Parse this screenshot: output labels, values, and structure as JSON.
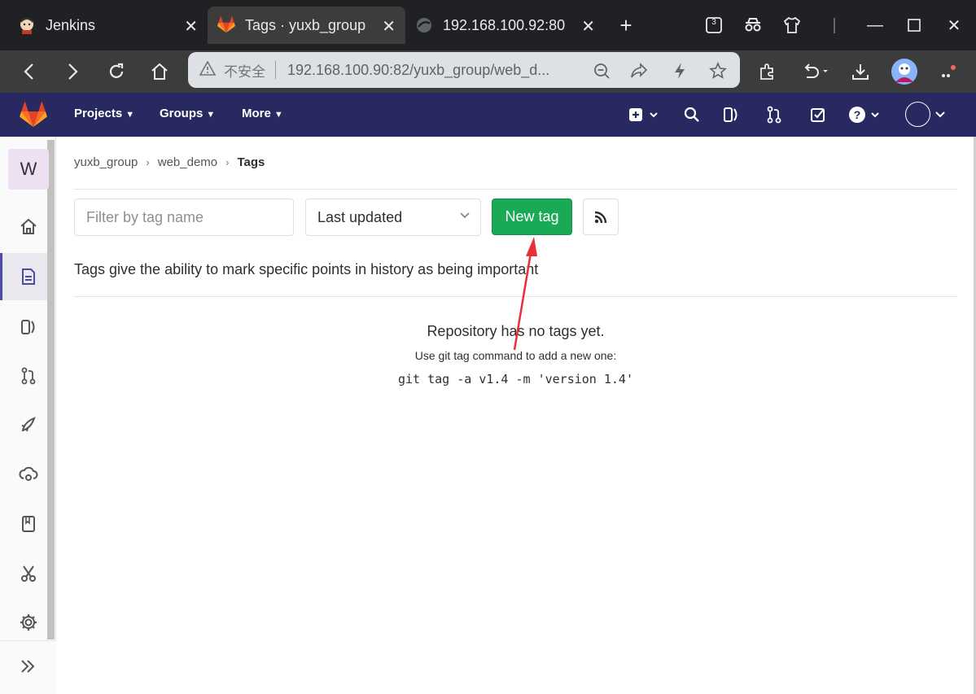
{
  "browser": {
    "tabs": [
      {
        "title": "Jenkins"
      },
      {
        "title": "Tags · yuxb_group"
      },
      {
        "title": "192.168.100.92:80"
      }
    ],
    "badge_count": "3",
    "insecure_label": "不安全",
    "url": "192.168.100.90:82/yuxb_group/web_d..."
  },
  "gitlab_nav": {
    "projects": "Projects",
    "groups": "Groups",
    "more": "More"
  },
  "sidebar": {
    "project_initial": "W"
  },
  "breadcrumb": {
    "group": "yuxb_group",
    "project": "web_demo",
    "current": "Tags"
  },
  "toolbar": {
    "filter_placeholder": "Filter by tag name",
    "sort_selected": "Last updated",
    "new_tag_label": "New tag"
  },
  "main": {
    "description": "Tags give the ability to mark specific points in history as being important",
    "empty_title": "Repository has no tags yet.",
    "empty_subtitle": "Use git tag command to add a new one:",
    "empty_command": "git tag -a v1.4 -m 'version 1.4'"
  },
  "colors": {
    "header_bg": "#292961",
    "primary_green": "#1aaa55",
    "annotation_arrow": "#e8303a"
  }
}
